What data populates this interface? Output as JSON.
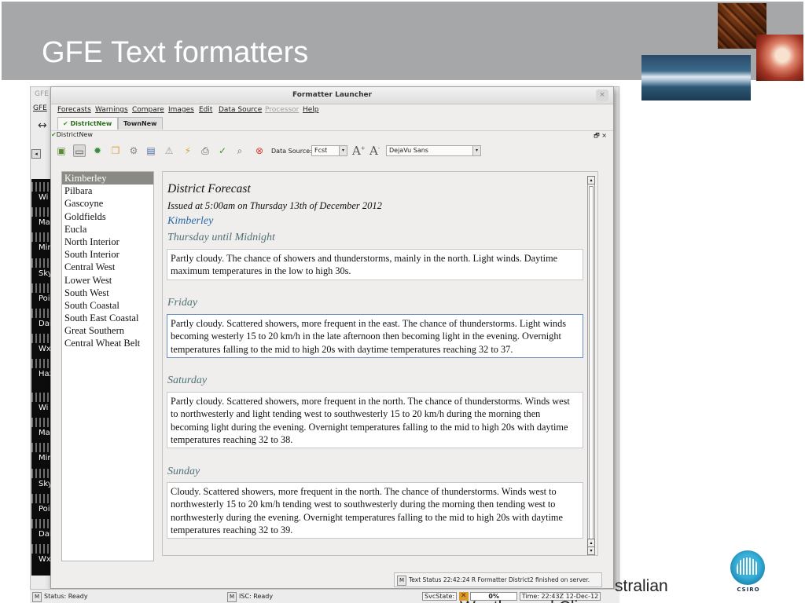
{
  "slide": {
    "title": "GFE Text formatters",
    "footer_text": "stralian",
    "footer_cut_text": "Weather and Cli",
    "logo_text": "CSIRO"
  },
  "gfe_window": {
    "title": "GFE",
    "menu_gfe": "GFE",
    "arrow_icon": "↔",
    "left_btn": "◂",
    "strip_labels": [
      "Wi",
      "Ma",
      "Mir",
      "Sky",
      "Poi",
      "Dai",
      "Wx",
      "Haz",
      "Wi",
      "Ma",
      "Mir",
      "Sky",
      "Poi",
      "Dai",
      "Wx"
    ],
    "status": {
      "m_label": "M",
      "status_text": "Status: Ready",
      "isc_m": "M",
      "isc_text": "ISC: Ready",
      "svcstate_label": "SvcState:",
      "svc_icon": "✕",
      "progress_percent": "0%",
      "time_text": "Time:  22:43Z 12-Dec-12"
    }
  },
  "launcher": {
    "title": "Formatter Launcher",
    "close": "×",
    "menu": [
      {
        "label": "Forecasts",
        "disabled": false
      },
      {
        "label": "Warnings",
        "disabled": false
      },
      {
        "label": "Compare",
        "disabled": false
      },
      {
        "label": "Images",
        "disabled": false
      },
      {
        "label": "Edit",
        "disabled": false
      },
      {
        "label": "Data Source",
        "disabled": false
      },
      {
        "label": "Processor",
        "disabled": true
      },
      {
        "label": "Help",
        "disabled": false
      }
    ],
    "tabs": [
      {
        "label": "DistrictNew",
        "tick": "✔",
        "active": true
      },
      {
        "label": "TownNew",
        "tick": "",
        "active": false
      }
    ],
    "sub_tab": {
      "tick": "✔",
      "label": "DistrictNew",
      "controls": "🗗 ×"
    },
    "toolbar": {
      "icons": [
        {
          "name": "image-icon",
          "glyph": "▣",
          "color": "#5a8a3a",
          "pressed": false
        },
        {
          "name": "text-view-icon",
          "glyph": "▭",
          "color": "#5a5a5a",
          "pressed": true
        },
        {
          "name": "bug-icon",
          "glyph": "✹",
          "color": "#3d8a3d",
          "pressed": false
        },
        {
          "name": "copy-icon",
          "glyph": "❐",
          "color": "#d4a340",
          "pressed": false
        },
        {
          "name": "settings-icon",
          "glyph": "⚙",
          "color": "#888888",
          "pressed": false
        },
        {
          "name": "save-icon",
          "glyph": "▤",
          "color": "#4f6fa8",
          "pressed": false
        },
        {
          "name": "warning-icon",
          "glyph": "⚠",
          "color": "#9a9a9a",
          "pressed": false
        },
        {
          "name": "transmit-icon",
          "glyph": "⚡",
          "color": "#d4a340",
          "pressed": false
        },
        {
          "name": "print-icon",
          "glyph": "⎙",
          "color": "#555555",
          "pressed": false
        },
        {
          "name": "spellcheck-icon",
          "glyph": "✓",
          "color": "#3a9b23",
          "pressed": false
        },
        {
          "name": "find-icon",
          "glyph": "⌕",
          "color": "#666666",
          "pressed": false
        },
        {
          "name": "stop-icon",
          "glyph": "⊗",
          "color": "#d93a2a",
          "pressed": false
        }
      ],
      "data_source_label": "Data Source:",
      "data_source_value": "Fcst",
      "font_increase": "A",
      "font_decrease": "A",
      "font_value": "DejaVu Sans",
      "dropdown_arrow": "▾"
    },
    "regions": [
      "Kimberley",
      "Pilbara",
      "Gascoyne",
      "Goldfields",
      "Eucla",
      "North Interior",
      "South Interior",
      "Central West",
      "Lower West",
      "South West",
      "South Coastal",
      "South East Coastal",
      "Great Southern",
      "Central Wheat Belt"
    ],
    "selected_region": "Kimberley",
    "forecast": {
      "title": "District Forecast",
      "issued": "Issued at 5:00am on Thursday 13th of December 2012",
      "region": "Kimberley",
      "periods": [
        {
          "day": "Thursday until Midnight",
          "text": "Partly cloudy. The chance of showers and thunderstorms, mainly in the north. Light winds. Daytime maximum temperatures in the low to high 30s."
        },
        {
          "day": "Friday",
          "text": "Partly cloudy. Scattered showers, more frequent in the east. The chance of thunderstorms. Light winds becoming westerly 15 to 20 km/h in the late afternoon then becoming light in the evening. Overnight temperatures falling to the mid to high 20s with daytime temperatures reaching 32 to 37."
        },
        {
          "day": "Saturday",
          "text": "Partly cloudy. Scattered showers, more frequent in the north. The chance of thunderstorms. Winds west to northwesterly and light tending west to southwesterly 15 to 20 km/h during the morning then becoming light during the evening. Overnight temperatures falling to the mid to high 20s with daytime temperatures reaching 32 to 38."
        },
        {
          "day": "Sunday",
          "text": "Cloudy. Scattered showers, more frequent in the north. The chance of thunderstorms. Winds west to northwesterly 15 to 20 km/h tending west to southwesterly during the morning then tending west to northwesterly during the evening. Overnight temperatures falling to the mid to high 20s with daytime temperatures reaching 32 to 39."
        }
      ]
    },
    "scroll_up": "▴",
    "scroll_down": "▾",
    "status": {
      "m_label": "M",
      "text": "Text Status  22:42:24 R Formatter District2 finished on server."
    }
  }
}
